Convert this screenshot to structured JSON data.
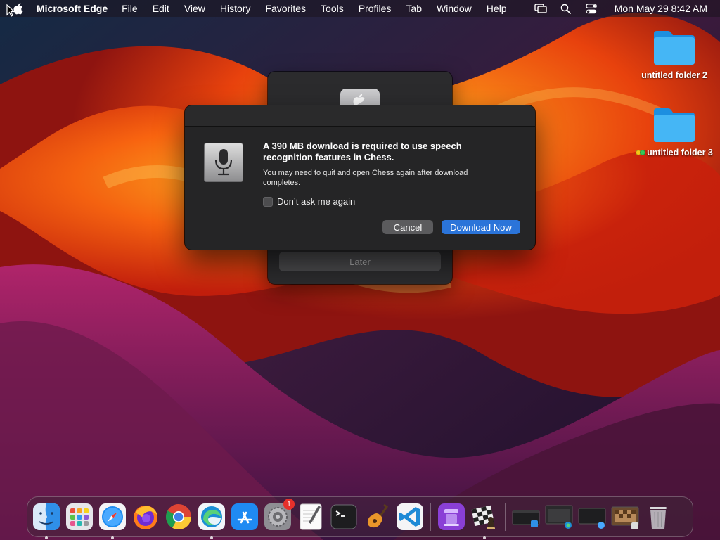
{
  "menubar": {
    "app_name": "Microsoft Edge",
    "menus": [
      "File",
      "Edit",
      "View",
      "History",
      "Favorites",
      "Tools",
      "Profiles",
      "Tab",
      "Window",
      "Help"
    ],
    "clock": "Mon May 29  8:42 AM",
    "status_icons": [
      "screen-mirroring-icon",
      "spotlight-search-icon",
      "control-center-icon"
    ]
  },
  "desktop": {
    "folders": [
      {
        "label": "untitled folder 2",
        "tags": []
      },
      {
        "label": "untitled folder 3",
        "tags": [
          "#f5c518",
          "#34c759"
        ]
      }
    ]
  },
  "back_window": {
    "later_label": "Later"
  },
  "dialog": {
    "headline": "A 390 MB download is required to use speech recognition features in Chess.",
    "body": "You may need to quit and open Chess again after download completes.",
    "checkbox_label": "Don’t ask me again",
    "checkbox_checked": false,
    "cancel_label": "Cancel",
    "download_label": "Download Now",
    "accent_color": "#2b74d9"
  },
  "dock": {
    "apps": [
      {
        "name": "Finder",
        "icon": "finder-icon",
        "running": true
      },
      {
        "name": "Launchpad",
        "icon": "launchpad-icon",
        "running": false
      },
      {
        "name": "Safari",
        "icon": "safari-icon",
        "running": true
      },
      {
        "name": "Firefox",
        "icon": "firefox-icon",
        "running": false
      },
      {
        "name": "Google Chrome",
        "icon": "chrome-icon",
        "running": false
      },
      {
        "name": "Microsoft Edge",
        "icon": "edge-icon",
        "running": true
      },
      {
        "name": "App Store",
        "icon": "app-store-icon",
        "running": false
      },
      {
        "name": "System Preferences",
        "icon": "system-preferences-icon",
        "running": false,
        "badge": "1"
      },
      {
        "name": "TextEdit",
        "icon": "textedit-icon",
        "running": false
      },
      {
        "name": "Terminal",
        "icon": "terminal-icon",
        "running": false
      },
      {
        "name": "GarageBand",
        "icon": "garageband-icon",
        "running": false
      },
      {
        "name": "Visual Studio Code",
        "icon": "vscode-icon",
        "running": false
      },
      {
        "name": "Podcasts",
        "icon": "podcasts-icon",
        "running": false
      },
      {
        "name": "Chess",
        "icon": "chess-icon",
        "running": true
      }
    ],
    "minimized_windows": [
      "finder-window-thumbnail",
      "edge-window-thumbnail",
      "safari-window-thumbnail",
      "chess-window-thumbnail"
    ],
    "trash": "trash-icon"
  }
}
